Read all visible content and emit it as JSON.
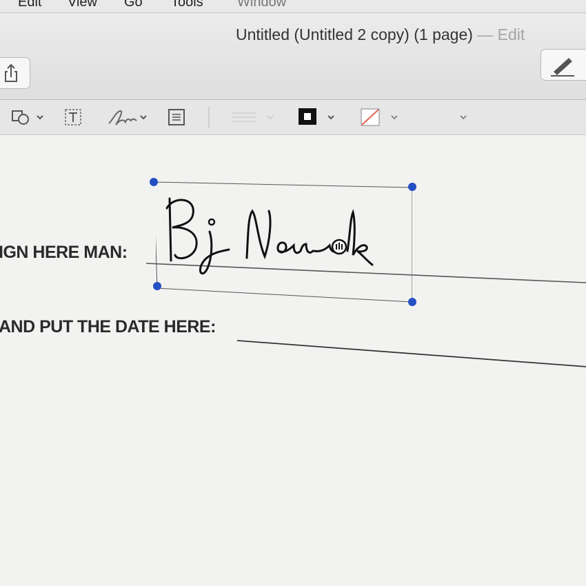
{
  "menubar": {
    "items": [
      "Edit",
      "View",
      "Go",
      "Tools",
      "Window"
    ]
  },
  "window": {
    "title_main": "Untitled (Untitled 2 copy) (1 page)",
    "title_suffix": "— Edit"
  },
  "toolbar": {
    "icons": [
      "shapes-icon",
      "text-icon",
      "sign-icon",
      "note-icon",
      "align-icon",
      "border-color-icon",
      "fill-color-icon",
      "font-icon"
    ],
    "border_color": "#111111",
    "fill_color": "#e0624f"
  },
  "document": {
    "sign_label": "IGN HERE MAN:",
    "date_label": "AND PUT THE DATE HERE:",
    "signature_text": "Bj Nowak",
    "selection_color": "#2450c4"
  }
}
